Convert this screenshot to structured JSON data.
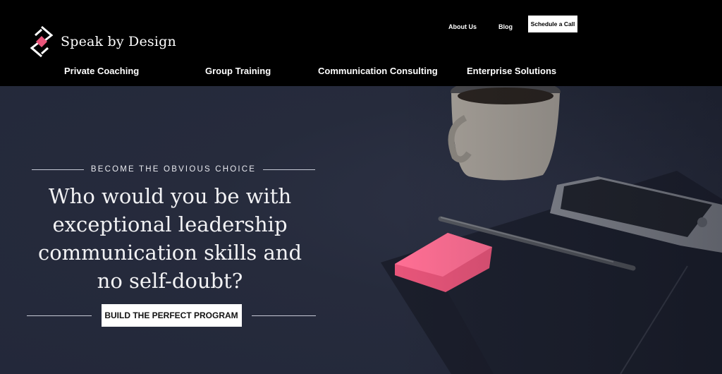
{
  "brand": {
    "name": "Speak by Design",
    "accent": "#e8557a"
  },
  "utility_nav": {
    "about": "About Us",
    "blog": "Blog",
    "cta": "Schedule a Call"
  },
  "main_nav": [
    "Private Coaching",
    "Group Training",
    "Communication Consulting",
    "Enterprise Solutions"
  ],
  "hero": {
    "eyebrow": "BECOME THE OBVIOUS CHOICE",
    "headline": "Who would you be with exceptional leadership communication skills and no self-doubt?",
    "cta": "BUILD THE PERFECT PROGRAM"
  }
}
